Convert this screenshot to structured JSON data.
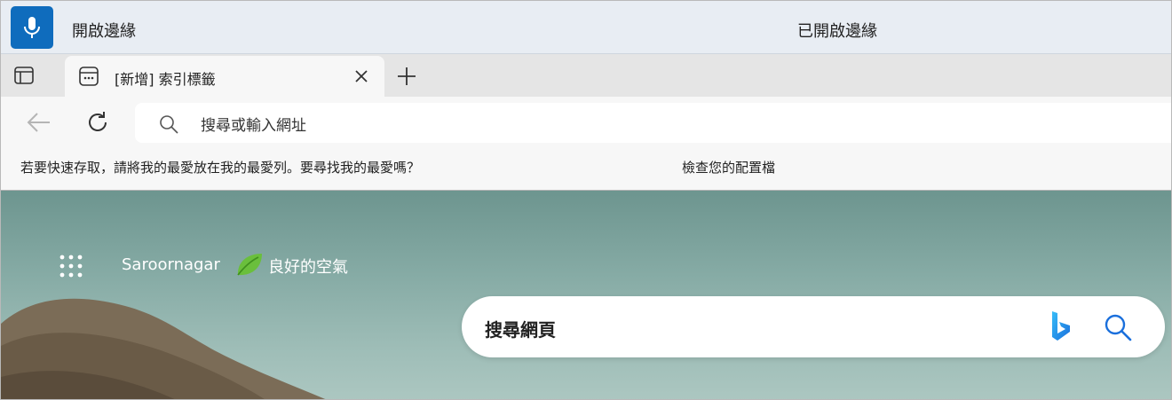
{
  "voice_access": {
    "mic_icon": "microphone-icon",
    "label": "開啟邊緣",
    "status": "已開啟邊緣"
  },
  "tabs": {
    "tab_actions_icon": "tab-actions-icon",
    "active_tab": {
      "favicon": "new-tab-page-icon",
      "title": "[新增] 索引標籤",
      "close_icon": "close-icon"
    },
    "new_tab_icon": "plus-icon"
  },
  "toolbar": {
    "back_icon": "back-arrow-icon",
    "reload_icon": "refresh-icon",
    "address": {
      "icon": "search-icon",
      "placeholder": "搜尋或輸入網址"
    }
  },
  "favorites_bar": {
    "message": "若要快速存取，請將我的最愛放在我的最愛列。要尋找我的最愛嗎？",
    "link": "檢查您的配置檔"
  },
  "new_tab_page": {
    "apps_icon": "app-launcher-icon",
    "location": "Saroornagar",
    "air_quality_icon": "leaf-icon",
    "air_quality": "良好的空氣",
    "search": {
      "placeholder": "搜尋網頁",
      "bing_icon": "bing-logo-icon",
      "search_icon": "search-icon"
    }
  },
  "colors": {
    "accent": "#0f6cbd",
    "voicebar_bg": "#e8edf3",
    "tabstrip_bg": "#e5e5e5",
    "toolbar_bg": "#f7f7f7",
    "ntp_bg": "#86aba5"
  }
}
